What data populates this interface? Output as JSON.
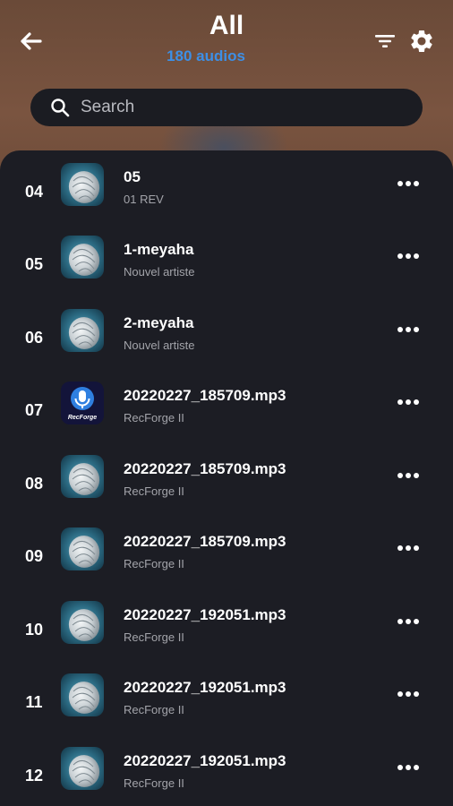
{
  "header": {
    "title": "All",
    "subtitle": "180 audios"
  },
  "search": {
    "placeholder": "Search",
    "value": ""
  },
  "colors": {
    "accent": "#3d8fe6",
    "background": "#1c1d24",
    "header_bg": "#74503d"
  },
  "tracks": [
    {
      "num": "04",
      "title": "05",
      "artist": "01  REV",
      "art": "disc"
    },
    {
      "num": "05",
      "title": "1-meyaha",
      "artist": "Nouvel artiste",
      "art": "disc"
    },
    {
      "num": "06",
      "title": "2-meyaha",
      "artist": "Nouvel artiste",
      "art": "disc"
    },
    {
      "num": "07",
      "title": "20220227_185709.mp3",
      "artist": "RecForge II",
      "art": "recforge-logo"
    },
    {
      "num": "08",
      "title": "20220227_185709.mp3",
      "artist": "RecForge II",
      "art": "disc"
    },
    {
      "num": "09",
      "title": "20220227_185709.mp3",
      "artist": "RecForge II",
      "art": "disc"
    },
    {
      "num": "10",
      "title": "20220227_192051.mp3",
      "artist": "RecForge II",
      "art": "disc"
    },
    {
      "num": "11",
      "title": "20220227_192051.mp3",
      "artist": "RecForge II",
      "art": "disc"
    },
    {
      "num": "12",
      "title": "20220227_192051.mp3",
      "artist": "RecForge II",
      "art": "disc"
    }
  ],
  "recforge_logo_text": "RecForge"
}
